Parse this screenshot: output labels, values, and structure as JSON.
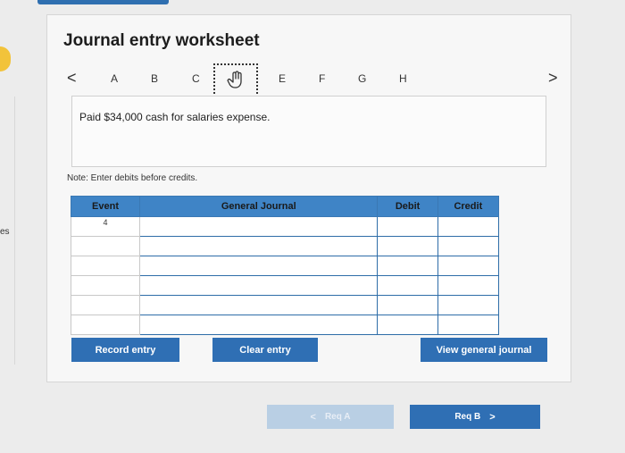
{
  "page": {
    "title": "Journal entry worksheet",
    "left_edge_text": "es"
  },
  "nav": {
    "prev_label": "<",
    "next_label": ">",
    "letters": [
      "A",
      "B",
      "C",
      "E",
      "F",
      "G",
      "H"
    ],
    "current_icon": "hand-pointer-icon"
  },
  "transaction": {
    "description": "Paid $34,000 cash for salaries expense."
  },
  "note": "Note: Enter debits before credits.",
  "journal": {
    "headers": [
      "Event",
      "General Journal",
      "Debit",
      "Credit"
    ],
    "rows": [
      {
        "event": "4",
        "account": "",
        "debit": "",
        "credit": ""
      },
      {
        "event": "",
        "account": "",
        "debit": "",
        "credit": ""
      },
      {
        "event": "",
        "account": "",
        "debit": "",
        "credit": ""
      },
      {
        "event": "",
        "account": "",
        "debit": "",
        "credit": ""
      },
      {
        "event": "",
        "account": "",
        "debit": "",
        "credit": ""
      },
      {
        "event": "",
        "account": "",
        "debit": "",
        "credit": ""
      }
    ]
  },
  "buttons": {
    "record": "Record entry",
    "clear": "Clear entry",
    "view": "View general journal"
  },
  "footer": {
    "req_a": "Req A",
    "req_b": "Req B",
    "prev_chevron": "<",
    "next_chevron": ">"
  },
  "colors": {
    "primary": "#2f6fb4",
    "header": "#3f84c6",
    "accent_yellow": "#f2c33a"
  }
}
